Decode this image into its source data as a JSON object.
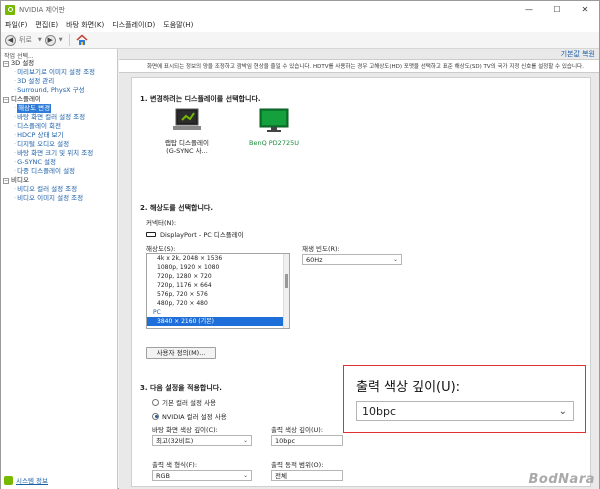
{
  "window": {
    "title": "NVIDIA 제어판",
    "controls": {
      "minimize": "—",
      "maximize": "☐",
      "close": "✕"
    }
  },
  "menu": [
    "파일(F)",
    "편집(E)",
    "바탕 화면(K)",
    "디스플레이(D)",
    "도움말(H)"
  ],
  "toolbar": {
    "back_label": "뒤로"
  },
  "left_panel": {
    "header": "작업 선택...",
    "tree": [
      {
        "label": "3D 설정",
        "level": 0,
        "expander": "−"
      },
      {
        "label": "미리보기로 이미지 설정 조정",
        "level": 1
      },
      {
        "label": "3D 설정 관리",
        "level": 1
      },
      {
        "label": "Surround, PhysX 구성",
        "level": 1
      },
      {
        "label": "디스플레이",
        "level": 0,
        "expander": "−"
      },
      {
        "label": "해상도 변경",
        "level": 1,
        "selected": true
      },
      {
        "label": "바탕 화면 컬러 설정 조정",
        "level": 1
      },
      {
        "label": "디스플레이 회전",
        "level": 1
      },
      {
        "label": "HDCP 상태 보기",
        "level": 1
      },
      {
        "label": "디지털 오디오 설정",
        "level": 1
      },
      {
        "label": "바탕 화면 크기 및 위치 조정",
        "level": 1
      },
      {
        "label": "G-SYNC 설정",
        "level": 1
      },
      {
        "label": "다중 디스플레이 설정",
        "level": 1
      },
      {
        "label": "비디오",
        "level": 0,
        "expander": "−"
      },
      {
        "label": "비디오 컬러 설정 조정",
        "level": 1
      },
      {
        "label": "비디오 이미지 설정 조정",
        "level": 1
      }
    ],
    "footer_link": "시스템 정보"
  },
  "main": {
    "restore_defaults": "기본값 복원",
    "description": "화면에 표시되는 정보의 양을 조정하고 깜박임 현상을 줄일 수 있습니다. HDTV를 사용하는 경우 고해상도(HD) 포맷을 선택하고 표준 해상도(SD) TV의 국가 지정 신호를 설정할 수 있습니다.",
    "section1": {
      "title": "1. 변경하려는 디스플레이를 선택합니다.",
      "displays": [
        {
          "name": "랩탑 디스플레이\n(G-SYNC 사...",
          "selected": false,
          "icon": "laptop-icon"
        },
        {
          "name": "BenQ PD2725U",
          "selected": true,
          "icon": "monitor-icon"
        }
      ]
    },
    "section2": {
      "title": "2. 해상도를 선택합니다.",
      "connector_label": "커넥터(N):",
      "connector_value": "DisplayPort - PC 디스플레이",
      "resolution_label": "해상도(S):",
      "resolutions": [
        {
          "text": "4k x 2k, 2048 × 1536"
        },
        {
          "text": "1080p, 1920 × 1080"
        },
        {
          "text": "720p, 1280 × 720"
        },
        {
          "text": "720p, 1176 × 664"
        },
        {
          "text": "576p, 720 × 576"
        },
        {
          "text": "480p, 720 × 480"
        },
        {
          "text": "PC",
          "group": true
        },
        {
          "text": "3840 × 2160 (기본)",
          "selected": true
        }
      ],
      "refresh_label": "재생 빈도(R):",
      "refresh_value": "60Hz",
      "custom_button": "사용자 정의(M)..."
    },
    "section3": {
      "title": "3. 다음 설정을 적용합니다.",
      "radio_default": "기본 컬러 설정 사용",
      "radio_nvidia": "NVIDIA 컬러 설정 사용",
      "desktop_depth_label": "바탕 화면 색상 깊이(C):",
      "desktop_depth_value": "최고(32비트)",
      "output_depth_label": "출력 색상 깊이(U):",
      "output_depth_value": "10bpc",
      "output_format_label": "출력 색 형식(F):",
      "output_format_value": "RGB",
      "dynamic_range_label": "출력 동적 범위(O):",
      "dynamic_range_value": "전체"
    }
  },
  "zoom_callout": {
    "label": "출력 색상 깊이(U):",
    "value": "10bpc",
    "border_color": "#e03030"
  },
  "watermark": "BodNara",
  "colors": {
    "nvidia_green": "#76b900",
    "selection_blue": "#1e6fd9",
    "link_blue": "#1a5fa8"
  }
}
